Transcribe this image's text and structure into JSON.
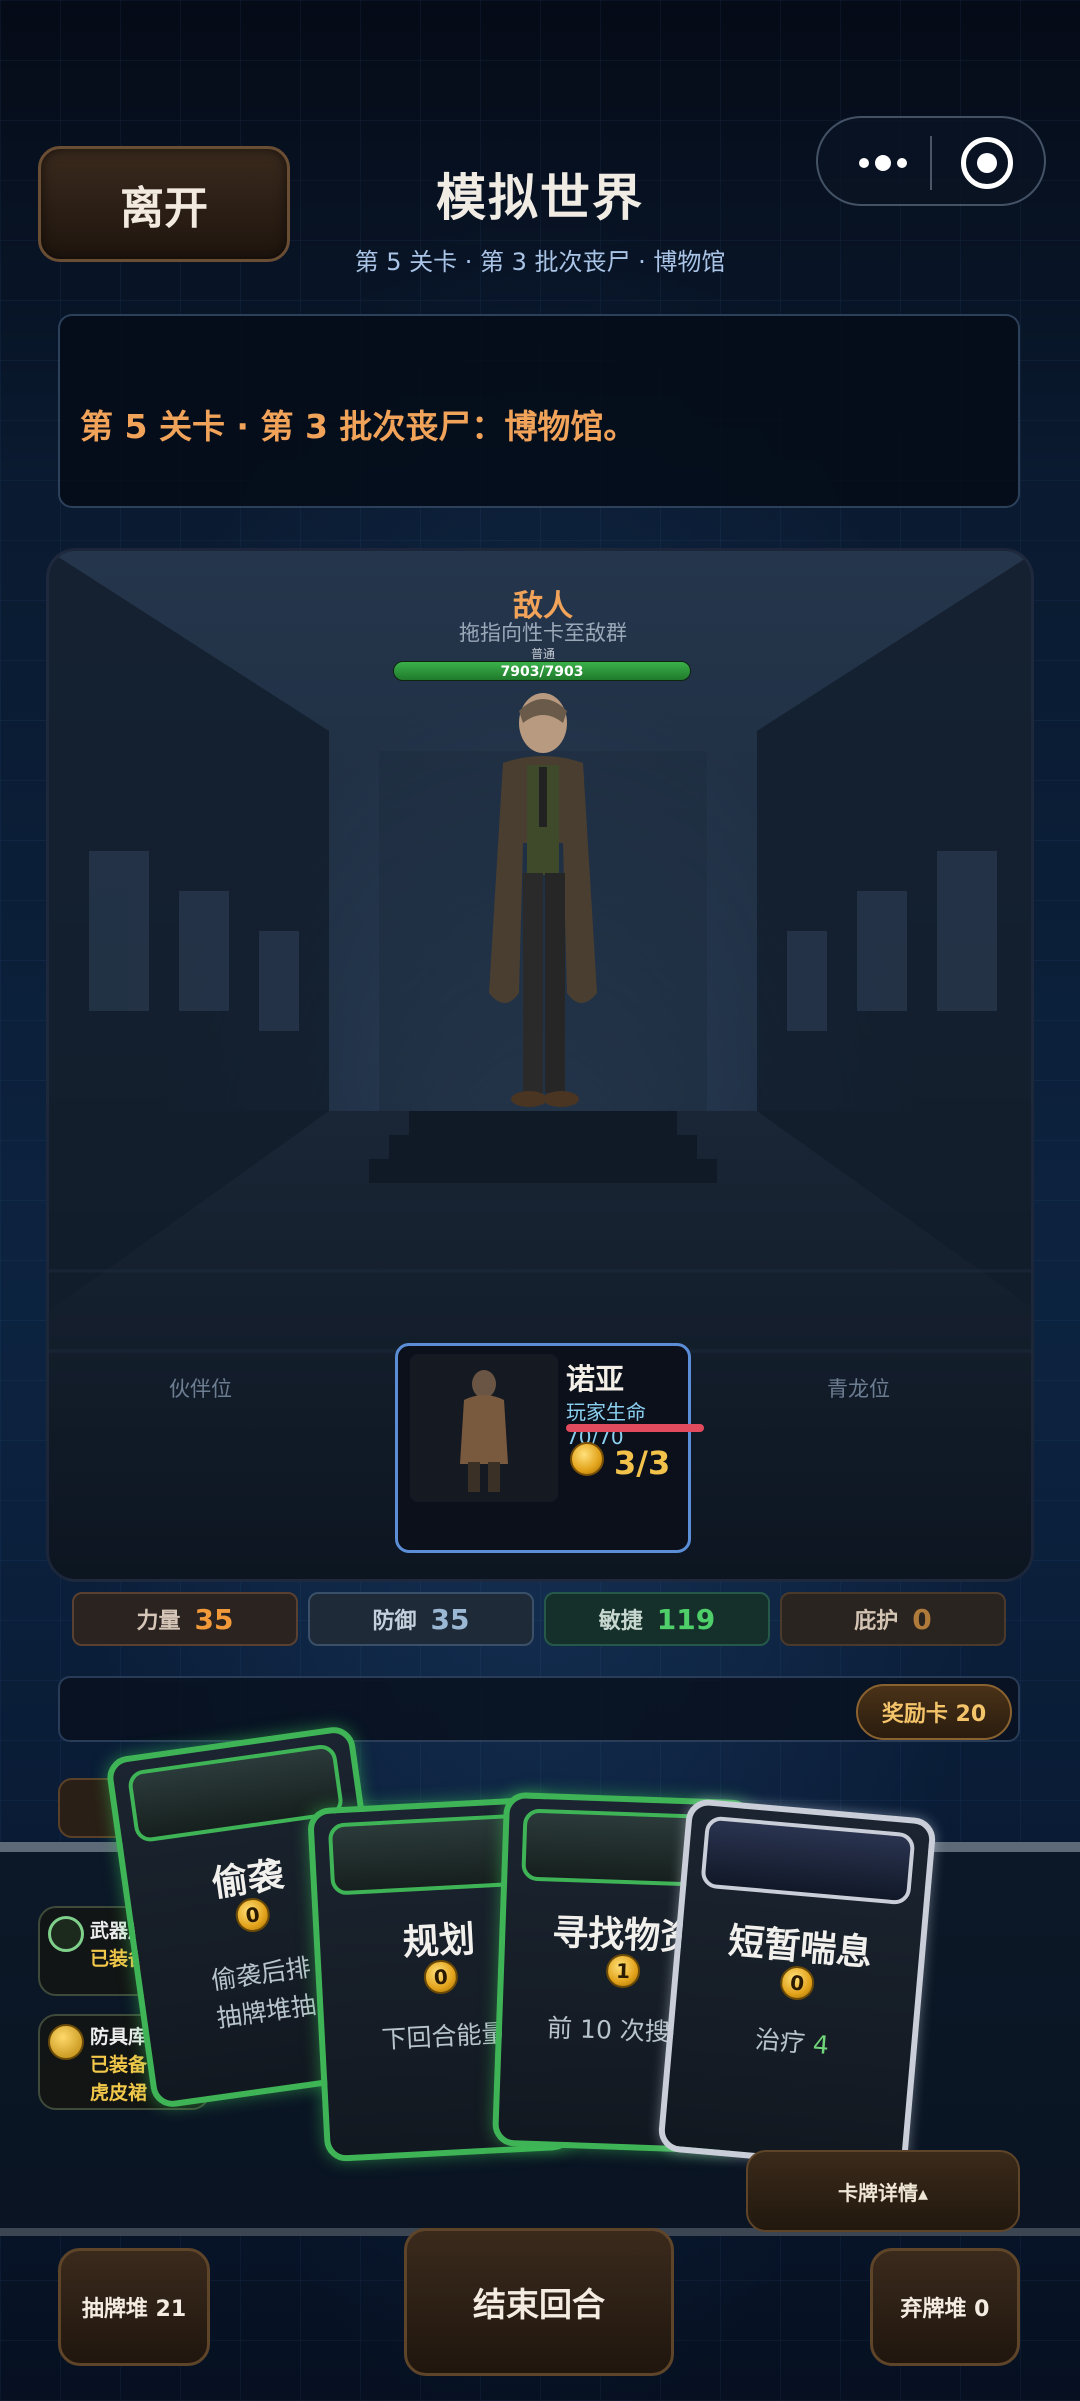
{
  "header": {
    "leave_label": "离开",
    "title": "模拟世界",
    "subtitle": "第 5 关卡 · 第 3 批次丧尸 · 博物馆"
  },
  "message": "第 5 关卡 · 第 3 批次丧尸：博物馆。",
  "enemy": {
    "name": "敌人",
    "hint": "拖指向性卡至敌群",
    "tier": "普通",
    "hp_text": "7903/7903",
    "hp_fraction": 1.0
  },
  "slots": {
    "left": "伙伴位",
    "right": "青龙位"
  },
  "player": {
    "name": "诺亚",
    "hp_text": "玩家生命 70/70",
    "energy": "3/3"
  },
  "stats": {
    "strength": {
      "label": "力量",
      "value": "35"
    },
    "defense": {
      "label": "防御",
      "value": "35"
    },
    "agility": {
      "label": "敏捷",
      "value": "119"
    },
    "shelter": {
      "label": "庇护",
      "value": "0"
    }
  },
  "reward_label": "奖励卡 20",
  "equipment": {
    "weapon": {
      "line1": "武器库 x3",
      "line2": "已装备 锤子"
    },
    "armor": {
      "line1": "防具库 x1",
      "line2": "已装备",
      "line3": "虎皮裙"
    }
  },
  "cards": [
    {
      "name": "偷袭",
      "cost": "0",
      "desc1": "偷袭后排",
      "desc2": "抽牌堆抽"
    },
    {
      "name": "规划",
      "cost": "0",
      "desc1": "下回合能量"
    },
    {
      "name": "寻找物资",
      "cost": "1",
      "desc1": "前 10 次搜寻"
    },
    {
      "name": "短暂喘息",
      "cost": "0",
      "desc_prefix": "治疗",
      "desc_value": "4"
    }
  ],
  "card_detail_label": "卡牌详情▴",
  "bottom": {
    "draw_pile": "抽牌堆 21",
    "end_turn": "结束回合",
    "discard_pile": "弃牌堆 0"
  },
  "colors": {
    "accent_orange": "#f2a35a",
    "card_green": "#3fb456",
    "energy_gold": "#f3c24a"
  }
}
